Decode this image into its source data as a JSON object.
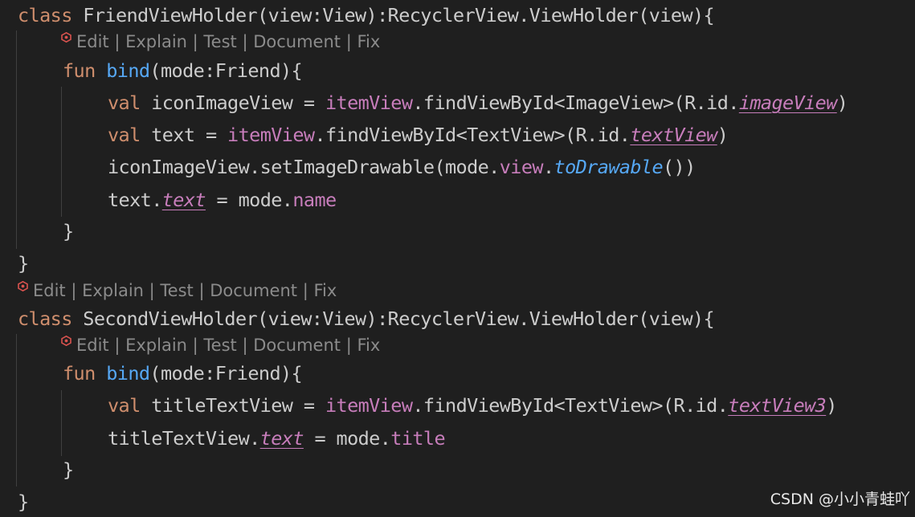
{
  "editor": {
    "accent_colors": {
      "keyword": "#cf8e6d",
      "function": "#56a8f5",
      "property": "#c77dbb",
      "text": "#cccccc",
      "codelens": "#8b8b8b",
      "background": "#1f1f1f"
    },
    "codelens": {
      "icon": "ai-assistant-icon",
      "edit": "Edit",
      "sep": " | ",
      "explain": "Explain",
      "test": "Test",
      "document": "Document",
      "fix": "Fix"
    },
    "l1": {
      "kw": "class",
      "rest": " FriendViewHolder(view:View):RecyclerView.ViewHolder(view){"
    },
    "l2": {
      "kw": "fun",
      "sp": " ",
      "fn": "bind",
      "rest": "(mode:Friend){"
    },
    "l3": {
      "kw": "val",
      "a": " iconImageView = ",
      "prop": "itemView",
      "b": ".findViewById<ImageView>(R.id.",
      "ref": "imageView",
      "c": ")"
    },
    "l4": {
      "kw": "val",
      "a": " text = ",
      "prop": "itemView",
      "b": ".findViewById<TextView>(R.id.",
      "ref": "textView",
      "c": ")"
    },
    "l5": {
      "a": "iconImageView.setImageDrawable(mode.",
      "prop": "view",
      "dot": ".",
      "fn": "toDrawable",
      "c": "())"
    },
    "l6": {
      "a": "text.",
      "ref": "text",
      "b": " = mode.",
      "prop": "name"
    },
    "l7": {
      "brace": "}"
    },
    "l8": {
      "brace": "}"
    },
    "l9": {
      "kw": "class",
      "rest": " SecondViewHolder(view:View):RecyclerView.ViewHolder(view){"
    },
    "l10": {
      "kw": "fun",
      "sp": " ",
      "fn": "bind",
      "rest": "(mode:Friend){"
    },
    "l11": {
      "kw": "val",
      "a": " titleTextView = ",
      "prop": "itemView",
      "b": ".findViewById<TextView>(R.id.",
      "ref": "textView3",
      "c": ")"
    },
    "l12": {
      "a": "titleTextView.",
      "ref": "text",
      "b": " = mode.",
      "prop": "title"
    },
    "l13": {
      "brace": "}"
    },
    "l14": {
      "brace": "}"
    }
  },
  "watermark": "CSDN @小小青蛙吖"
}
